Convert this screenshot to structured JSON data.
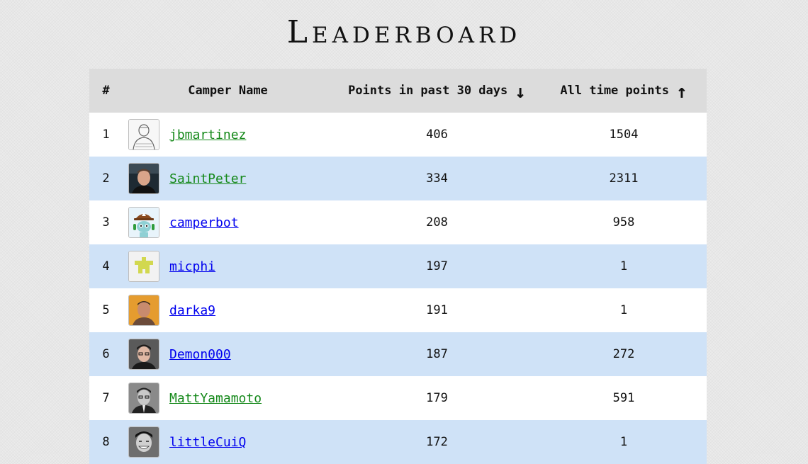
{
  "page": {
    "title": "Leaderboard"
  },
  "table": {
    "headers": {
      "rank": "#",
      "name": "Camper Name",
      "recent": "Points in past 30 days",
      "alltime": "All time points"
    },
    "sort_icons": {
      "recent": "arrow-down-icon",
      "alltime": "arrow-up-icon"
    },
    "row_colors": {
      "odd": "#ffffff",
      "even": "#cfe2f7"
    },
    "link_colors": {
      "visited": "#15891a",
      "unvisited": "#0000ee"
    },
    "rows": [
      {
        "rank": "1",
        "username": "jbmartinez",
        "recent": "406",
        "alltime": "1504",
        "link_color": "#15891a"
      },
      {
        "rank": "2",
        "username": "SaintPeter",
        "recent": "334",
        "alltime": "2311",
        "link_color": "#15891a"
      },
      {
        "rank": "3",
        "username": "camperbot",
        "recent": "208",
        "alltime": "958",
        "link_color": "#0000ee"
      },
      {
        "rank": "4",
        "username": "micphi",
        "recent": "197",
        "alltime": "1",
        "link_color": "#0000ee"
      },
      {
        "rank": "5",
        "username": "darka9",
        "recent": "191",
        "alltime": "1",
        "link_color": "#0000ee"
      },
      {
        "rank": "6",
        "username": "Demon000",
        "recent": "187",
        "alltime": "272",
        "link_color": "#0000ee"
      },
      {
        "rank": "7",
        "username": "MattYamamoto",
        "recent": "179",
        "alltime": "591",
        "link_color": "#15891a"
      },
      {
        "rank": "8",
        "username": "littleCuiQ",
        "recent": "172",
        "alltime": "1",
        "link_color": "#0000ee"
      }
    ]
  }
}
